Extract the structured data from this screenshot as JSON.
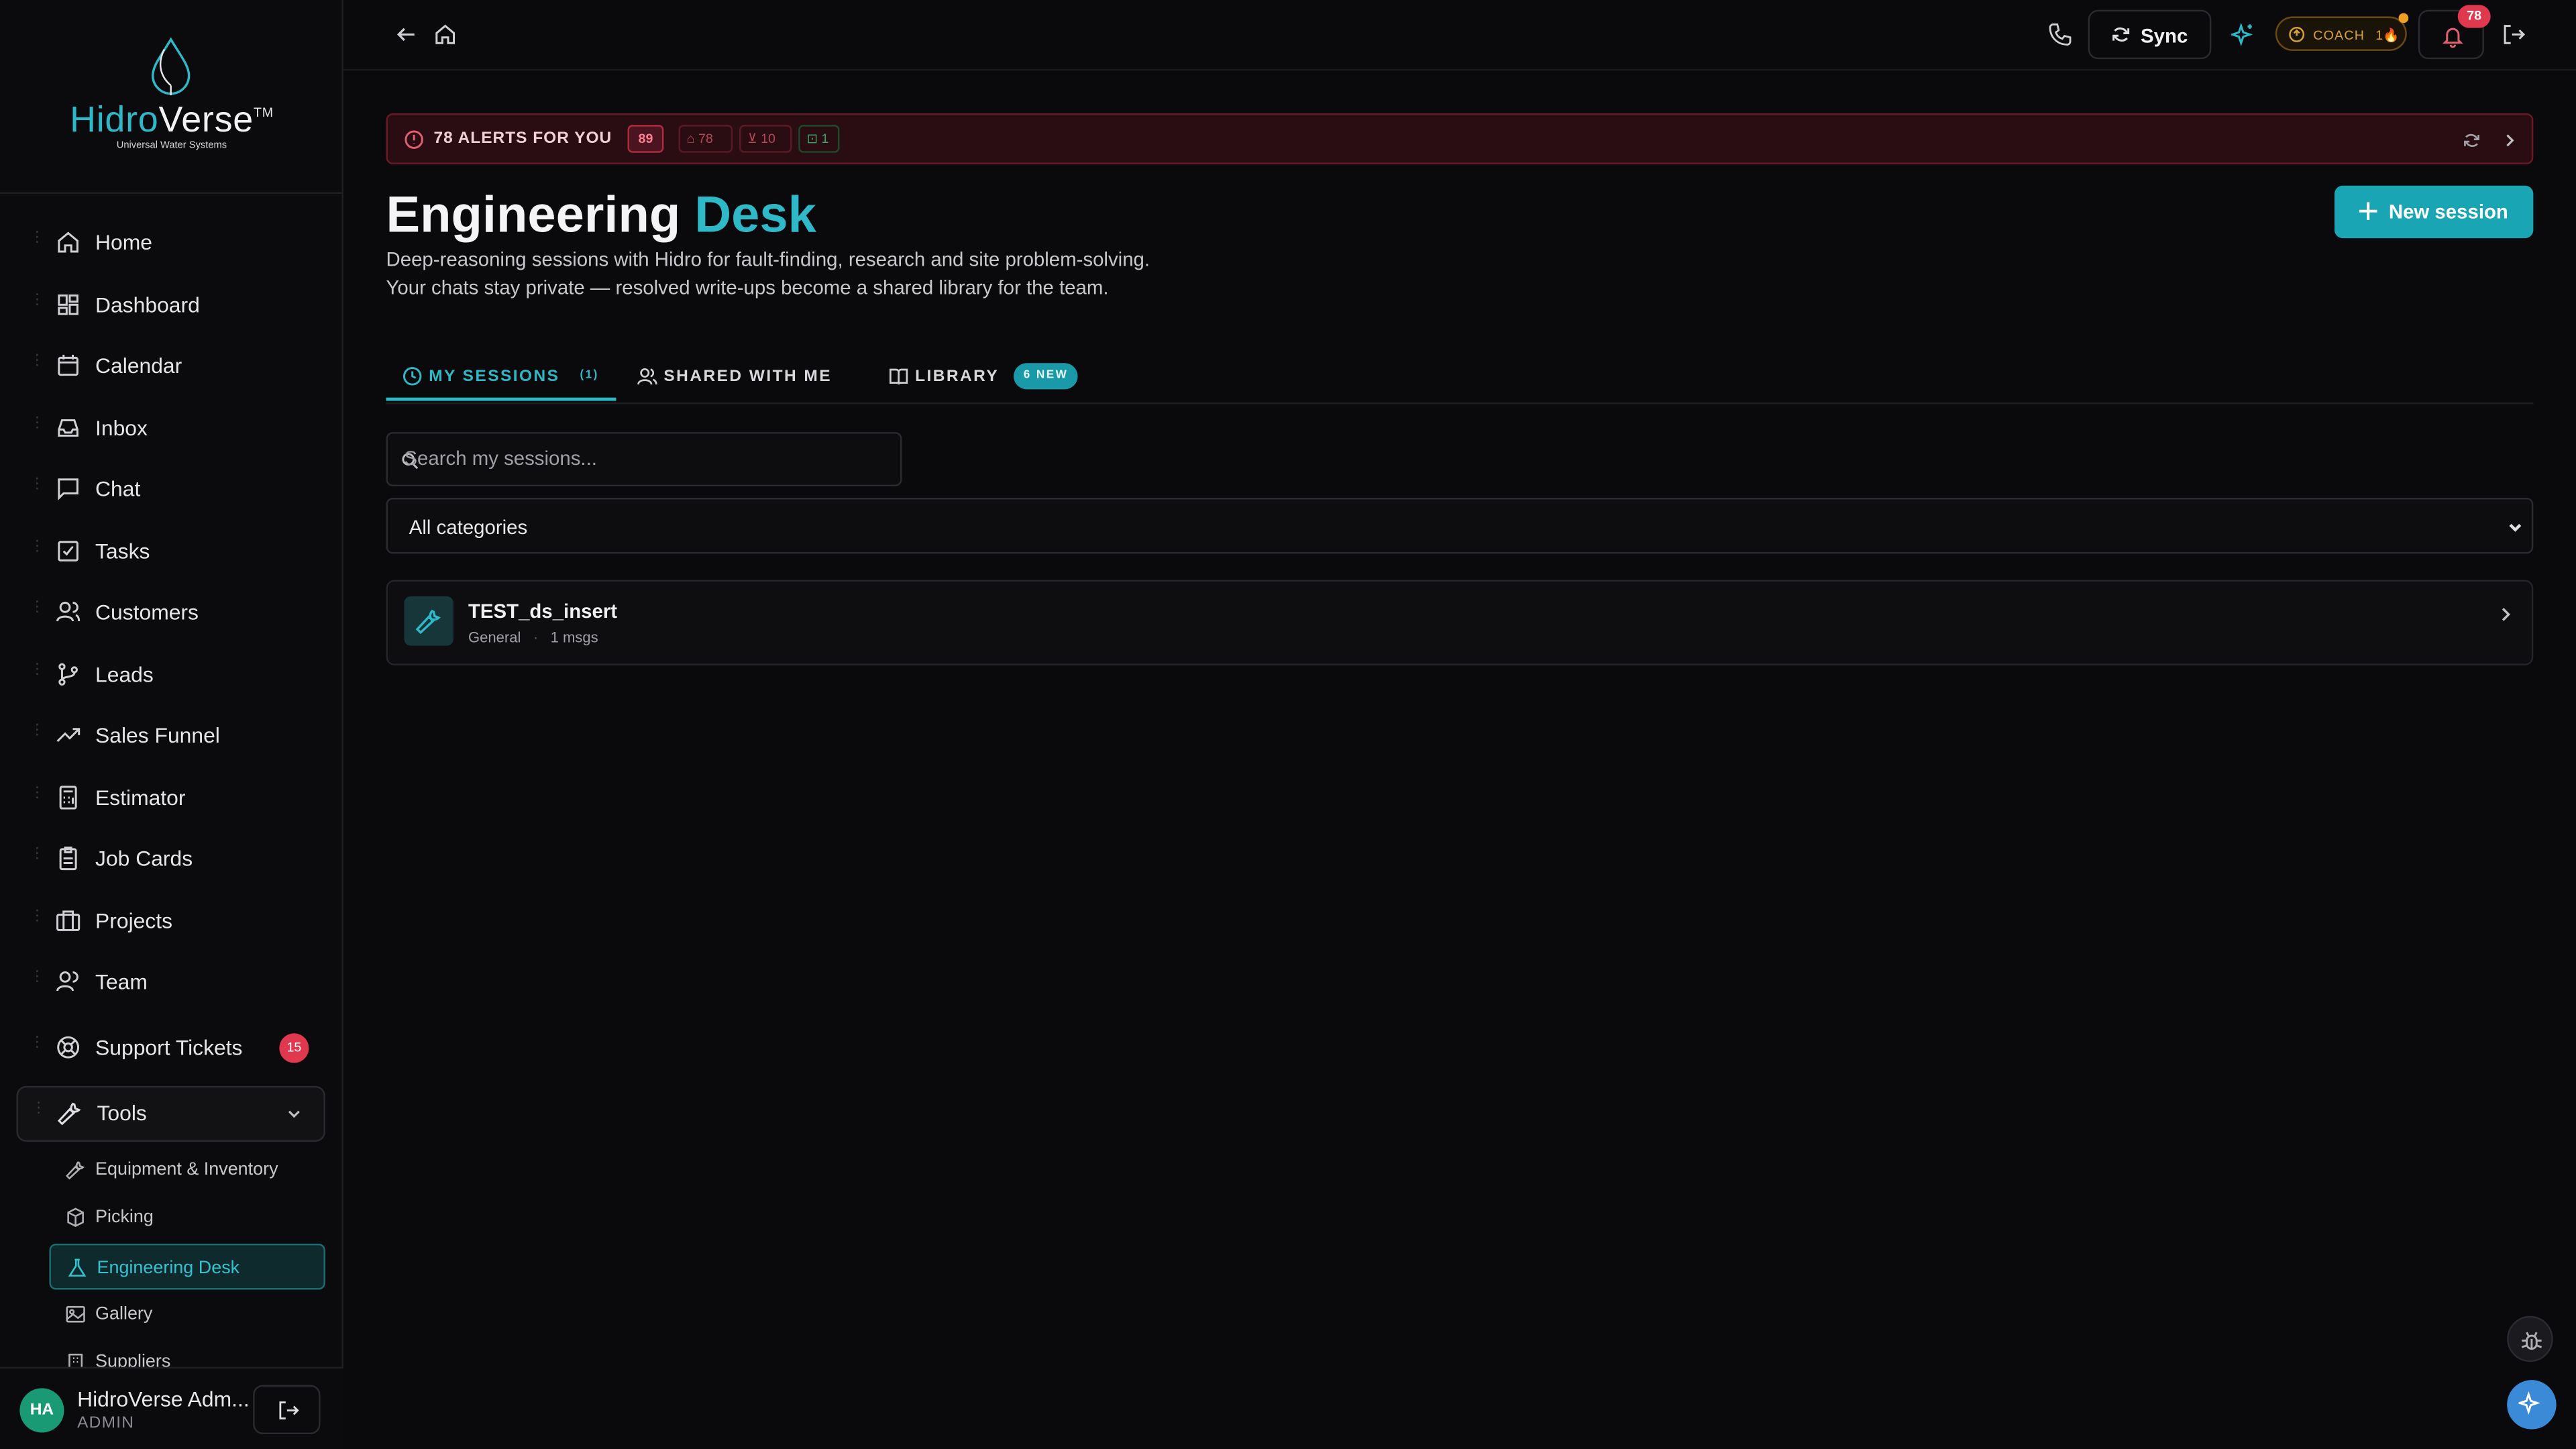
{
  "brand": {
    "name_part1": "Hidro",
    "name_part2": "Verse",
    "tm": "TM",
    "tagline": "Universal Water Systems"
  },
  "sidebar": {
    "items": [
      {
        "label": "Home",
        "icon": "home-icon"
      },
      {
        "label": "Dashboard",
        "icon": "dashboard-icon"
      },
      {
        "label": "Calendar",
        "icon": "calendar-icon"
      },
      {
        "label": "Inbox",
        "icon": "inbox-icon"
      },
      {
        "label": "Chat",
        "icon": "chat-icon"
      },
      {
        "label": "Tasks",
        "icon": "tasks-icon"
      },
      {
        "label": "Customers",
        "icon": "customers-icon"
      },
      {
        "label": "Leads",
        "icon": "leads-icon"
      },
      {
        "label": "Sales Funnel",
        "icon": "trending-up-icon"
      },
      {
        "label": "Estimator",
        "icon": "calculator-icon"
      },
      {
        "label": "Job Cards",
        "icon": "clipboard-icon"
      },
      {
        "label": "Projects",
        "icon": "briefcase-icon"
      },
      {
        "label": "Team",
        "icon": "team-icon"
      },
      {
        "label": "Support Tickets",
        "icon": "lifebuoy-icon",
        "badge": "15"
      },
      {
        "label": "Tools",
        "icon": "wrench-icon"
      }
    ],
    "tools_sub": [
      {
        "label": "Equipment & Inventory"
      },
      {
        "label": "Picking"
      },
      {
        "label": "Engineering Desk"
      },
      {
        "label": "Gallery"
      },
      {
        "label": "Suppliers"
      }
    ]
  },
  "user": {
    "initials": "HA",
    "name": "HidroVerse Adm...",
    "role": "ADMIN"
  },
  "topbar": {
    "sync_label": "Sync",
    "coach_label": "COACH",
    "coach_count": "1🔥",
    "notification_count": "78"
  },
  "alerts": {
    "title": "78 ALERTS FOR YOU",
    "total": "89",
    "chips": [
      {
        "value": "78",
        "icon": "gift-icon"
      },
      {
        "value": "10",
        "icon": "cart-icon"
      },
      {
        "value": "1",
        "icon": "lock-icon"
      }
    ]
  },
  "page": {
    "title_part1": "Engineering",
    "title_part2": "Desk",
    "description": "Deep-reasoning sessions with Hidro for fault-finding, research and site problem-solving. Your chats stay private — resolved write-ups become a shared library for the team.",
    "new_session_label": "New session"
  },
  "tabs": [
    {
      "label": "MY SESSIONS",
      "count": "(1)"
    },
    {
      "label": "SHARED WITH ME"
    },
    {
      "label": "LIBRARY",
      "pill": "6 NEW"
    }
  ],
  "search": {
    "placeholder": "Search my sessions..."
  },
  "category_filter": {
    "selected": "All categories"
  },
  "sessions": [
    {
      "name": "TEST_ds_insert",
      "category": "General",
      "messages": "1 msgs"
    }
  ],
  "colors": {
    "accent": "#2fb8c8",
    "alert": "#e0384f",
    "background": "#0a0a0c"
  }
}
